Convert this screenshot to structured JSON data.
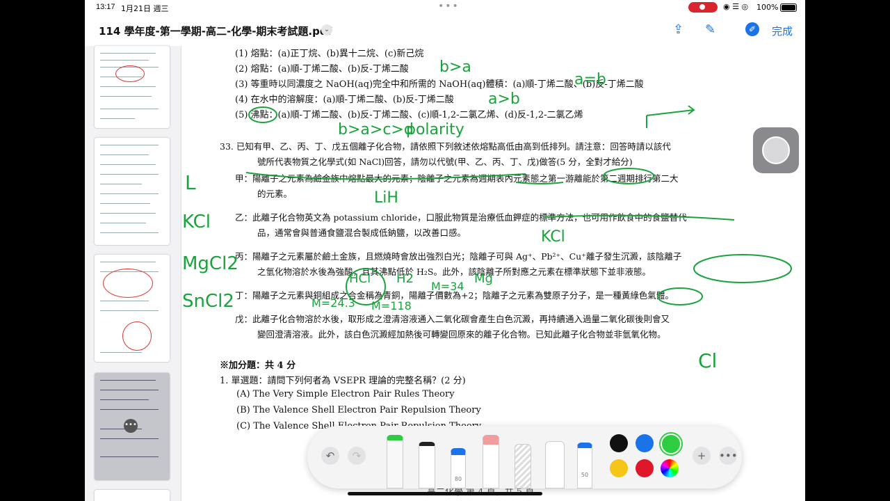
{
  "status": {
    "time": "13:17",
    "date": "1月21日 週三",
    "battery": "100%"
  },
  "document": {
    "title": "114 學年度-第一學期-高二-化學-期末考試題.pdf"
  },
  "toolbar": {
    "done_label": "完成"
  },
  "content": {
    "lines": [
      "(1)  熔點：(a)正丁烷、(b)異十二烷、(c)新己烷",
      "(2)  熔點：(a)順-丁烯二酸、(b)反-丁烯二酸",
      "(3)  等重時以同濃度之 NaOH(aq)完全中和所需的 NaOH(aq)體積：(a)順-丁烯二酸、(b)反-丁烯二酸",
      "(4)  在水中的溶解度：(a)順-丁烯二酸、(b)反-丁烯二酸",
      "(5)  沸點：(a)順-丁烯二酸、(b)反-丁烯二酸、(c)順-1,2-二氯乙烯、(d)反-1,2-二氯乙烯"
    ],
    "q33": [
      "33.  已知有甲、乙、丙、丁、戊五個離子化合物，請依照下列敘述依熔點高低由高到低排列。請注意：回答時請以該代",
      "號所代表物質之化學式(如 NaCl)回答，請勿以代號(甲、乙、丙、丁、戊)做答(5 分，全對才給分)",
      "甲：陽離子之元素為鹼金族中熔點最大的元素；陰離子之元素為週期表內元素態之第一游離能於第二週期排行第二大",
      "的元素。",
      "乙：此離子化合物英文為 potassium chloride，口服此物質是治療低血鉀症的標準方法，也可用作飲食中的食鹽替代",
      "品，通常會與普通食鹽混合製成低鈉鹽，以改善口感。",
      "丙：陽離子之元素屬於鹼土金族，且燃燒時會放出強烈白光；陰離子可與 Ag⁺、Pb²⁺、Cu⁺離子發生沉澱，該陰離子",
      "之氫化物溶於水後為強酸，且其沸點低於 H₂S。此外，該陰離子所對應之元素在標準狀態下並非液態。",
      "丁：陽離子之元素與銅組成之合金稱為青銅，陽離子價數為+2；陰離子之元素為雙原子分子，是一種黃綠色氣體。",
      "戊：此離子化合物溶於水後，取形成之澄清溶液通入二氧化碳會產生白色沉澱，再持續通入過量二氧化碳後則會又",
      "變回澄清溶液。此外，該白色沉澱經加熱後可轉變回原來的離子化合物。已知此離子化合物並非氫氧化物。"
    ],
    "bonus_title": "※加分題：共 4 分",
    "bonus_q": "1.  單選題：請問下列何者為 VSEPR 理論的完整名稱？(2 分)",
    "options": [
      "(A) The Very Simple Electron Pair Rules Theory",
      "(B) The Valence Shell Electron Pair Repulsion Theory",
      "(C) The Valence Shell Electron Pair Repulsion Theory"
    ],
    "footer": "高二化學  第 4 頁，共 5 頁"
  },
  "handwriting": [
    "b>a",
    "a>b",
    "a=b",
    "b>a>c>d",
    "polarity",
    "LiH",
    "KCl",
    "KCl",
    "MgCl2",
    "SnCl2",
    "L",
    "Cl",
    "M=24.3",
    "M=118",
    "M=34",
    "Mg",
    "HCl",
    "H2"
  ],
  "palette": {
    "colors": [
      "#111111",
      "#1a73e8",
      "#2ecc40",
      "#f5c518",
      "#e0162b"
    ],
    "marker_size": "80",
    "pencil_size": "50"
  }
}
